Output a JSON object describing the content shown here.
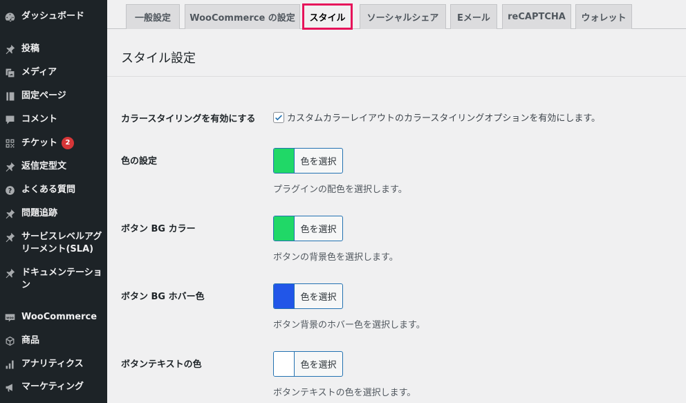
{
  "sidebar": {
    "items": [
      {
        "label": "ダッシュボード",
        "icon": "dashboard-icon"
      },
      {
        "label": "投稿",
        "icon": "pin-icon"
      },
      {
        "label": "メディア",
        "icon": "media-icon"
      },
      {
        "label": "固定ページ",
        "icon": "page-icon"
      },
      {
        "label": "コメント",
        "icon": "comment-icon"
      },
      {
        "label": "チケット",
        "icon": "grid-icon",
        "badge": "2"
      },
      {
        "label": "返信定型文",
        "icon": "pin-icon"
      },
      {
        "label": "よくある質問",
        "icon": "question-icon"
      },
      {
        "label": "問題追跡",
        "icon": "pin-icon"
      },
      {
        "label": "サービスレベルアグリーメント(SLA)",
        "icon": "pin-icon"
      },
      {
        "label": "ドキュメンテーション",
        "icon": "pin-icon"
      },
      {
        "label": "WooCommerce",
        "icon": "woo-icon"
      },
      {
        "label": "商品",
        "icon": "cube-icon"
      },
      {
        "label": "アナリティクス",
        "icon": "bar-chart-icon"
      },
      {
        "label": "マーケティング",
        "icon": "megaphone-icon"
      }
    ]
  },
  "tabs": [
    {
      "label": "一般設定"
    },
    {
      "label": "WooCommerce の設定"
    },
    {
      "label": "スタイル",
      "active": true
    },
    {
      "label": "ソーシャルシェア"
    },
    {
      "label": "Eメール"
    },
    {
      "label": "reCAPTCHA"
    },
    {
      "label": "ウォレット"
    }
  ],
  "page_title": "スタイル設定",
  "settings": {
    "styling": {
      "label": "カラースタイリングを有効にする",
      "checkbox_text": "カスタムカラーレイアウトのカラースタイリングオプションを有効にします。",
      "checked": true
    },
    "colors": [
      {
        "label": "色の設定",
        "button": "色を選択",
        "color": "#20d867",
        "description": "プラグインの配色を選択します。"
      },
      {
        "label": "ボタン BG カラー",
        "button": "色を選択",
        "color": "#20d867",
        "description": "ボタンの背景色を選択します。"
      },
      {
        "label": "ボタン BG ホバー色",
        "button": "色を選択",
        "color": "#2156e8",
        "description": "ボタン背景のホバー色を選択します。"
      },
      {
        "label": "ボタンテキストの色",
        "button": "色を選択",
        "color": "#ffffff",
        "description": "ボタンテキストの色を選択します。"
      }
    ]
  },
  "theme": {
    "accent": "#e6135a",
    "sidebar_bg": "#1d2327"
  }
}
